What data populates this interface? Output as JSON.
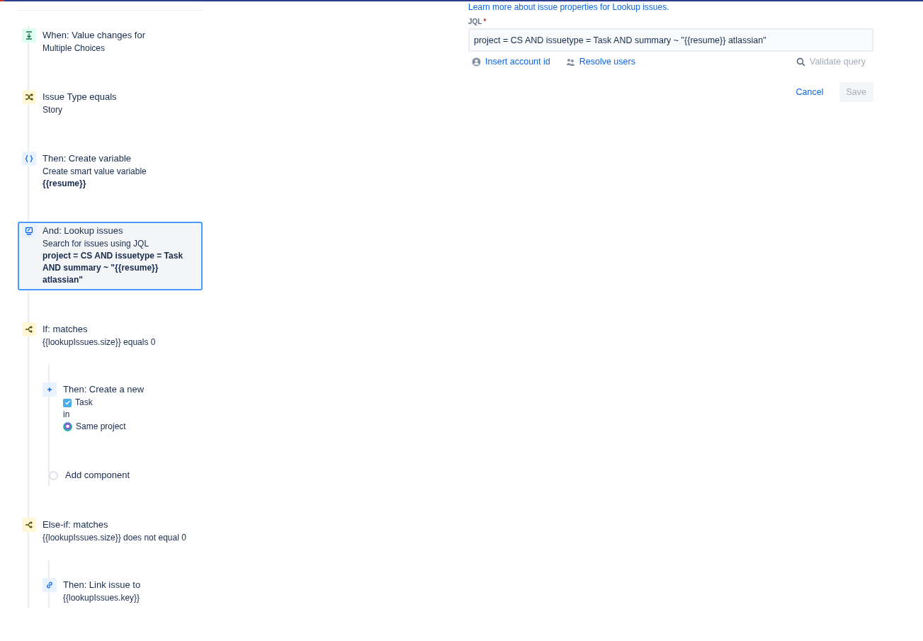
{
  "learn_more_link": "Learn more about issue properties for Lookup issues.",
  "rules": [
    {
      "kind": "trigger",
      "title": "When: Value changes for",
      "details": [
        {
          "kind": "plain",
          "text": "Multiple Choices"
        }
      ],
      "selected": false
    },
    {
      "kind": "condition",
      "title": "Issue Type equals",
      "details": [
        {
          "kind": "plain",
          "text": "Story"
        }
      ],
      "selected": false
    },
    {
      "kind": "variable",
      "title": "Then: Create variable",
      "details": [
        {
          "kind": "plain",
          "text": "Create smart value variable"
        },
        {
          "kind": "strong",
          "text": "{{resume}}"
        }
      ],
      "selected": false
    },
    {
      "kind": "lookup",
      "title": "And: Lookup issues",
      "details": [
        {
          "kind": "plain",
          "text": "Search for issues using JQL"
        },
        {
          "kind": "strong",
          "text": "project = CS AND issuetype = Task AND summary ~ \"{{resume}} atlassian\""
        }
      ],
      "selected": true
    },
    {
      "kind": "branch",
      "title": "If: matches",
      "details": [
        {
          "kind": "plain",
          "text": "{{lookupIssues.size}} equals 0"
        }
      ],
      "selected": false,
      "children": [
        {
          "kind": "create",
          "title": "Then: Create a new",
          "details": [
            {
              "kind": "issue-type",
              "text": "Task"
            },
            {
              "kind": "plain",
              "text": "in"
            },
            {
              "kind": "project",
              "text": "Same project"
            }
          ]
        },
        {
          "kind": "add",
          "title": "Add component"
        }
      ]
    },
    {
      "kind": "branch",
      "title": "Else-if: matches",
      "details": [
        {
          "kind": "plain",
          "text": "{{lookupIssues.size}} does not equal 0"
        }
      ],
      "selected": false,
      "children": [
        {
          "kind": "link",
          "title": "Then: Link issue to",
          "details": [
            {
              "kind": "plain",
              "text": "{{lookupIssues.key}}"
            }
          ]
        }
      ]
    }
  ],
  "jql": {
    "label": "JQL",
    "required_mark": "*",
    "value": "project = CS AND issuetype = Task AND summary ~ \"{{resume}} atlassian\""
  },
  "jql_actions": [
    {
      "kind": "account",
      "label": "Insert account id",
      "disabled": false
    },
    {
      "kind": "users",
      "label": "Resolve users",
      "disabled": false
    },
    {
      "kind": "validate",
      "label": "Validate query",
      "disabled": true
    }
  ],
  "buttons": [
    {
      "kind": "cancel",
      "label": "Cancel",
      "disabled": false
    },
    {
      "kind": "save",
      "label": "Save",
      "disabled": true
    }
  ]
}
